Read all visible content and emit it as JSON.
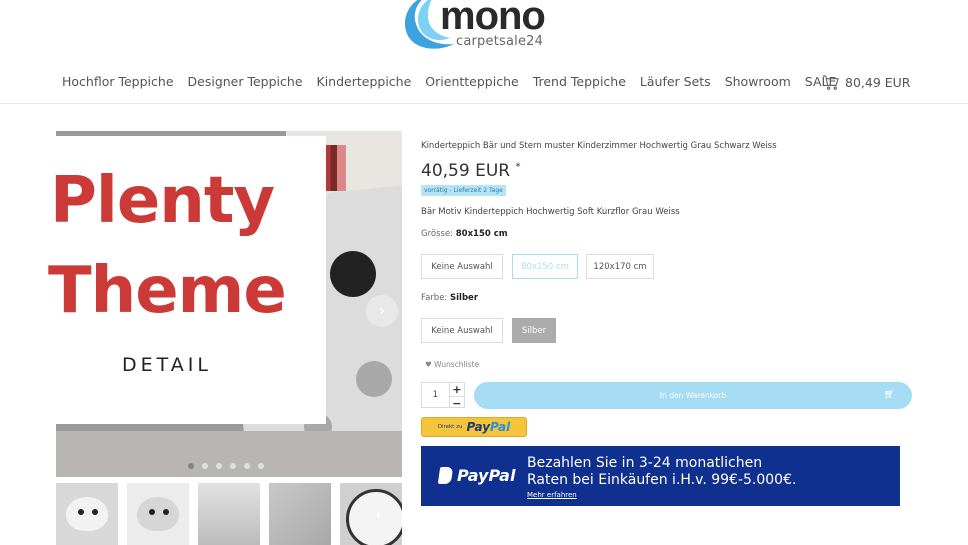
{
  "header": {
    "logo_main": "mono",
    "logo_sub": "carpetsale24",
    "nav": [
      "Hochflor Teppiche",
      "Designer Teppiche",
      "Kinderteppiche",
      "Orientteppiche",
      "Trend Teppiche",
      "Läufer Sets",
      "Showroom",
      "SALE"
    ],
    "cart_total": "80,49 EUR",
    "cart_icon": "cart-icon"
  },
  "overlay": {
    "line1": "Plenty",
    "line2": "Theme",
    "line3": "DETAIL"
  },
  "gallery": {
    "next_icon": "›",
    "thumb_next_icon": "›"
  },
  "product": {
    "title": "Kinderteppich Bär und Stern muster Kinderzimmer Hochwertig Grau Schwarz Weiss",
    "price": "40,59 EUR",
    "price_mark": "*",
    "availability": "vorrätig - Lieferzeit 2 Tage",
    "short_description": "Bär Motiv Kinderteppich Hochwertig Soft Kurzflor Grau Weiss",
    "size_label": "Grösse:",
    "size_value": "80x150 cm",
    "size_options": [
      "Keine Auswahl",
      "80x150 cm",
      "120x170 cm"
    ],
    "color_label": "Farbe:",
    "color_value": "Silber",
    "color_options": [
      "Keine Auswahl",
      "Silber"
    ],
    "wishlist": "Wunschliste",
    "quantity": "1",
    "qty_plus": "+",
    "qty_minus": "−",
    "add_to_cart": "In den Warenkorb"
  },
  "paypal": {
    "button_small": "Direkt zu",
    "button_pay": "Pay",
    "button_pal": "Pal",
    "banner_brand": "PayPal",
    "banner_line1": "Bezahlen Sie in 3-24 monatlichen",
    "banner_line2": "Raten bei Einkäufen i.H.v. 99€-5.000€.",
    "banner_more": "Mehr erfahren"
  },
  "colors": {
    "accent_red": "#cc3a37",
    "accent_blue": "#a6dcf3",
    "paypal_navy": "#10308f",
    "paypal_yellow": "#f6c43a"
  }
}
